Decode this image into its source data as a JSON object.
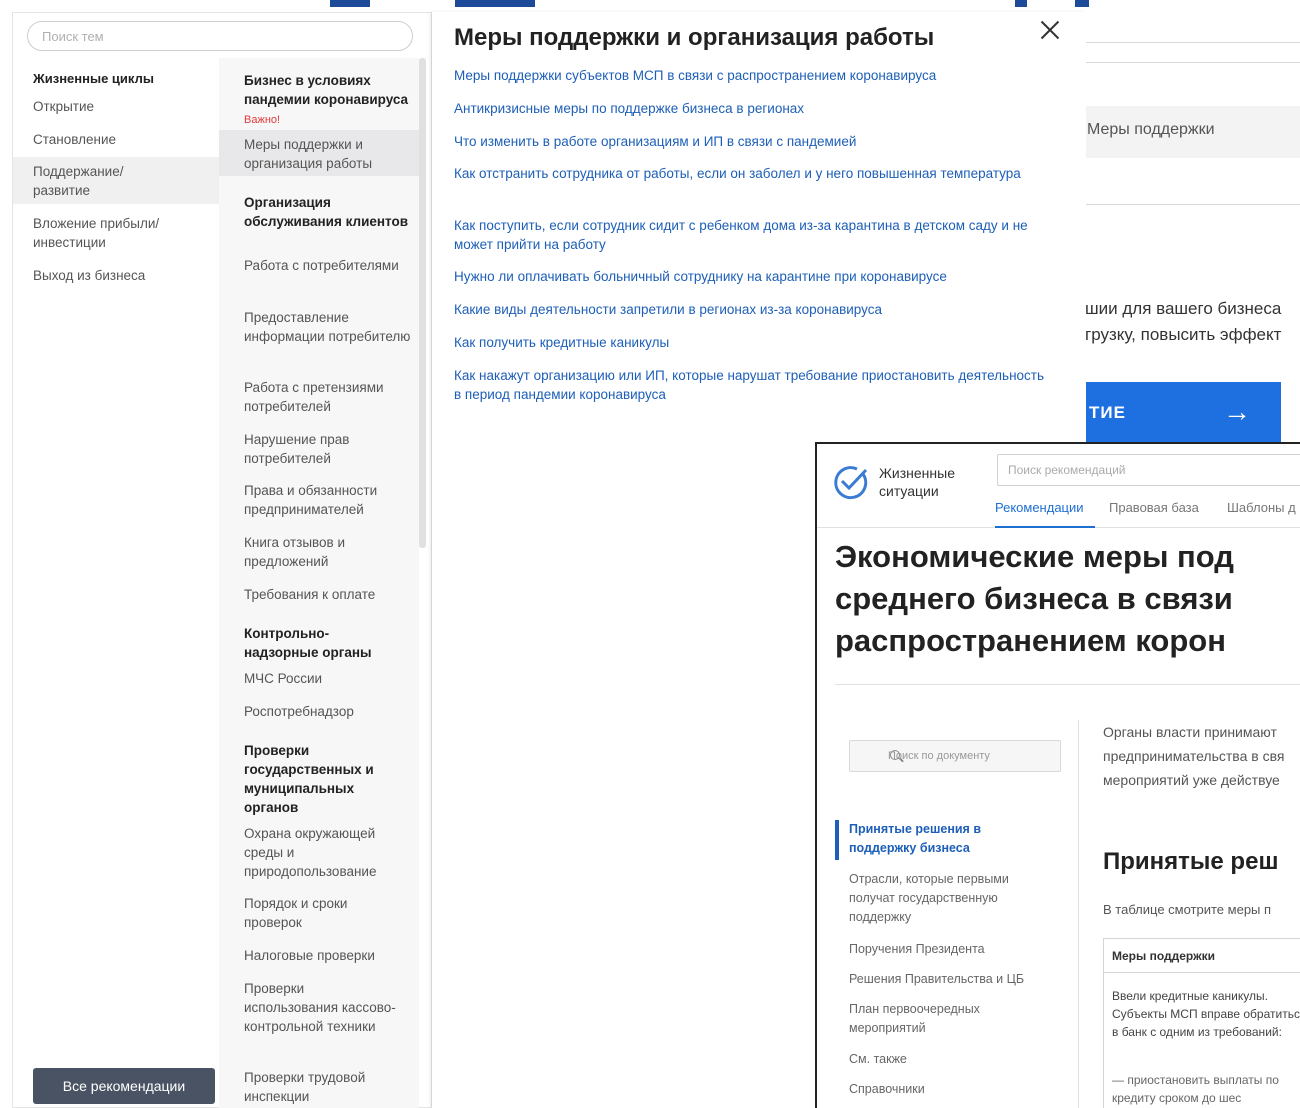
{
  "background": {
    "label_measures": "Меры поддержки",
    "text_line_1": "шии для вашего бизнеса",
    "text_line_2": "грузку, повысить эффект",
    "button_label": "ТИЕ",
    "button_arrow": "→"
  },
  "nav": {
    "search_placeholder": "Поиск тем",
    "lifecycle_heading": "Жизненные циклы",
    "lifecycle_items": [
      "Открытие",
      "Становление",
      "Поддержание/ развитие",
      "Вложение прибыли/ инвестиции",
      "Выход из бизнеса"
    ],
    "groups": [
      {
        "title": "Бизнес в условиях пандемии коронавируса",
        "badge": "Важно!"
      },
      {
        "title": "Меры поддержки и организация работы"
      },
      {
        "title": "Организация обслуживания клиентов"
      },
      {
        "title": "Работа с потребителями"
      },
      {
        "title": "Предоставление информации потребителю"
      },
      {
        "title": "Работа с претензиями потребителей"
      },
      {
        "title": "Нарушение прав потребителей"
      },
      {
        "title": "Права и обязанности предпринимателей"
      },
      {
        "title": "Книга отзывов и предложений"
      },
      {
        "title": "Требования к оплате"
      },
      {
        "title": "Контрольно-надзорные органы"
      },
      {
        "title": "МЧС России"
      },
      {
        "title": "Роспотребнадзор"
      },
      {
        "title": "Проверки государственных и муниципальных органов"
      },
      {
        "title": "Охрана окружающей среды и природопользование"
      },
      {
        "title": "Порядок и сроки проверок"
      },
      {
        "title": "Налоговые проверки"
      },
      {
        "title": "Проверки использования кассово-контрольной техники"
      },
      {
        "title": "Проверки трудовой инспекции"
      }
    ],
    "all_button": "Все рекомендации"
  },
  "article": {
    "title": "Меры поддержки и организация работы",
    "links": [
      "Меры поддержки субъектов МСП в связи с распространением коронавируса",
      "Антикризисные меры по поддержке бизнеса в регионах",
      "Что изменить в работе организациям и ИП в связи с пандемией",
      "Как отстранить сотрудника от работы, если он заболел и у него повышенная температура",
      "Как поступить, если сотрудник сидит с ребенком дома из-за карантина в детском саду и не может прийти на работу",
      "Нужно ли оплачивать больничный сотруднику на карантине при коронавирусе",
      "Какие виды деятельности запретили в регионах из-за коронавируса",
      "Как получить кредитные каникулы",
      "Как накажут организацию или ИП, которые нарушат требование приостановить деятельность в период пандемии коронавируса"
    ]
  },
  "card": {
    "logo_text": "Жизненные ситуации",
    "search_placeholder": "Поиск рекомендаций",
    "tabs": [
      "Рекомендации",
      "Правовая база",
      "Шаблоны д"
    ],
    "headline": [
      "Экономические меры под",
      "среднего бизнеса в связи",
      "распространением корон"
    ],
    "doc_search_placeholder": "Поиск по документу",
    "doc_nav": [
      "Принятые решения в поддержку бизнеса",
      "Отрасли, которые первыми получат государственную поддержку",
      "Поручения Президента",
      "Решения Правительства и ЦБ",
      "План первоочередных мероприятий",
      "См. также",
      "Справочники"
    ],
    "body_lines": [
      "Органы власти принимают",
      "предпринимательства в свя",
      "мероприятий уже действуе"
    ],
    "section_title": "Принятые реш",
    "section_note": "В таблице смотрите меры п",
    "table_header": "Меры поддержки",
    "table_cell": "Ввели кредитные каникулы. Субъекты МСП вправе обратиться в банк с одним из требований:",
    "table_cell_2": "— приостановить выплаты по кредиту сроком до шес"
  },
  "colors": {
    "link": "#1d5fb8",
    "accent": "#1e6fe0",
    "warning": "#e23b3b",
    "button_dark": "#4a5364"
  }
}
